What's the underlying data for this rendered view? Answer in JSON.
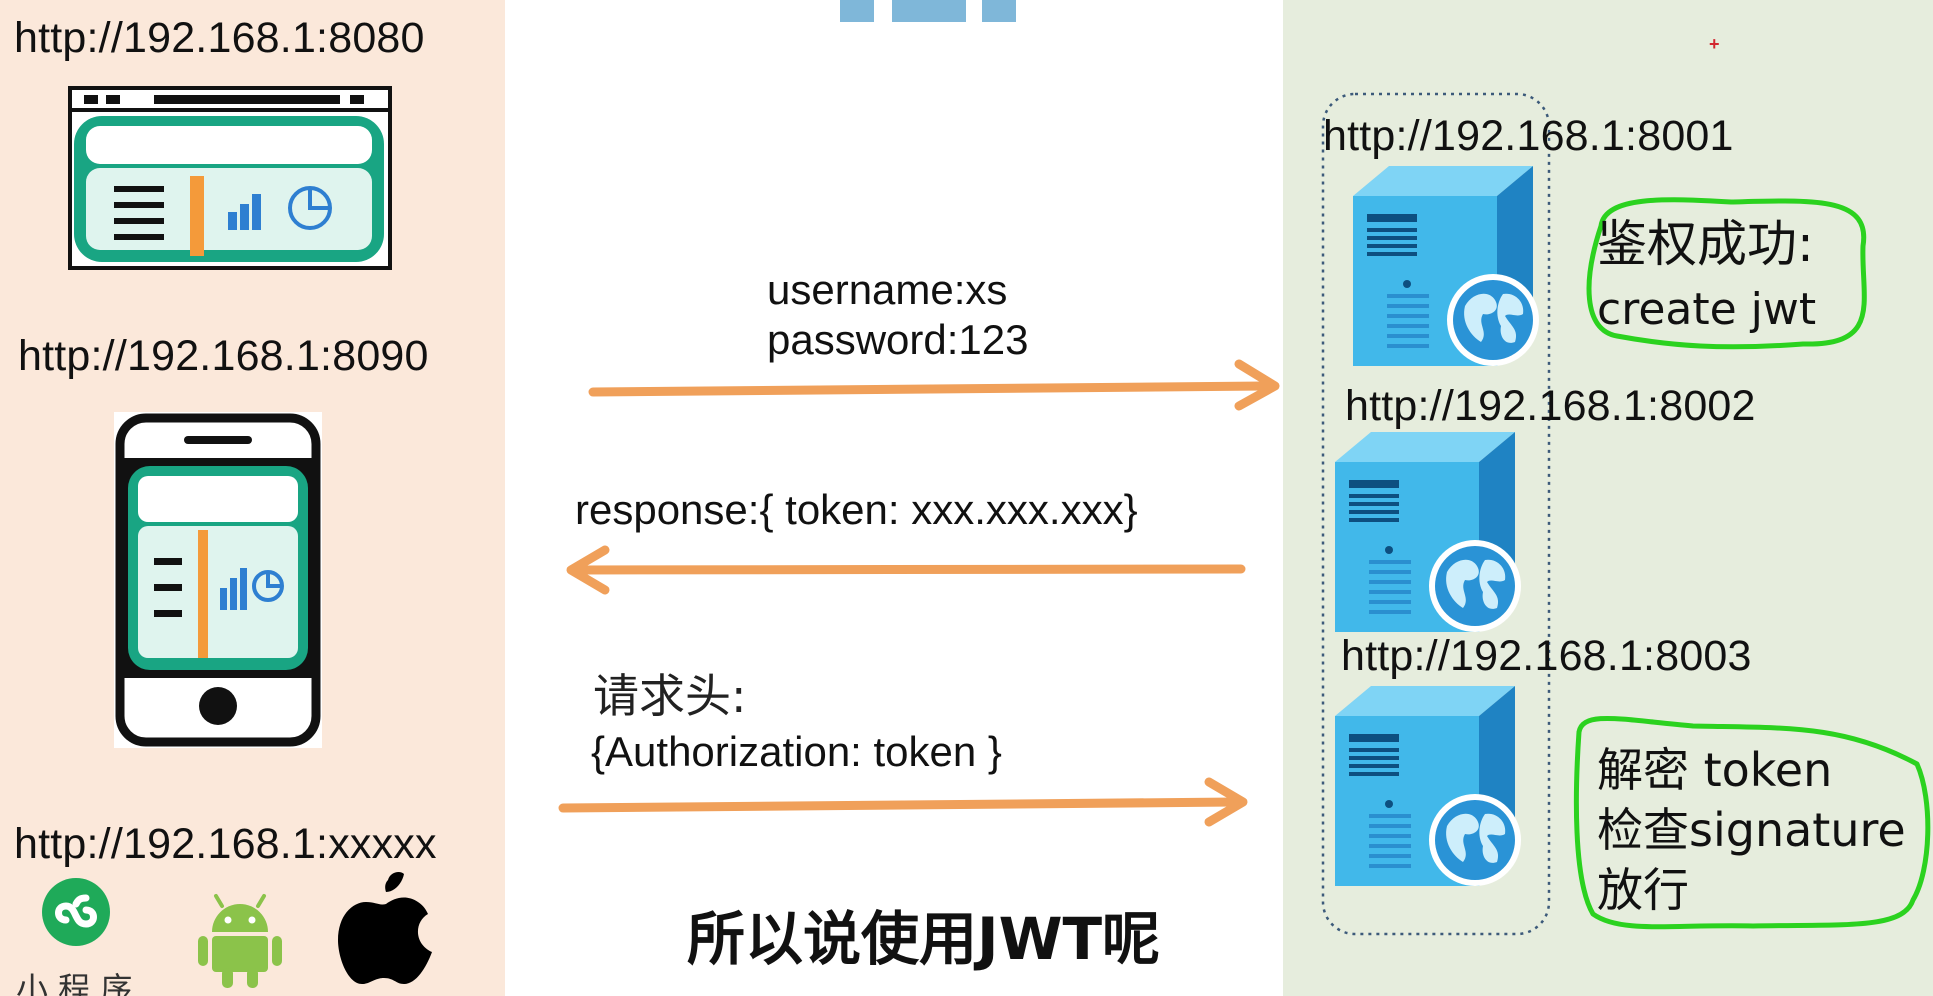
{
  "left": {
    "urls": {
      "web": "http://192.168.1:8080",
      "mobile": "http://192.168.1:8090",
      "other": "http://192.168.1:xxxxx"
    },
    "mini_program_label": "小 程 序"
  },
  "middle": {
    "login_request": [
      "username:xs",
      "password:123"
    ],
    "login_response": "response:{ token: xxx.xxx.xxx}",
    "auth_header": [
      "请求头:",
      "{Authorization: token }"
    ],
    "caption": "所以说使用JWT呢"
  },
  "right": {
    "servers": [
      {
        "url": "http://192.168.1:8001"
      },
      {
        "url": "http://192.168.1:8002"
      },
      {
        "url": "http://192.168.1:8003"
      }
    ],
    "note_auth": [
      "鉴权成功:",
      "create jwt"
    ],
    "note_verify": [
      "解密 token",
      "检查signature",
      "放行"
    ]
  },
  "colors": {
    "left_bg": "#fbe8da",
    "right_bg": "#e6eddd",
    "arrow": "#f0a05a",
    "highlight": "#2bd21f",
    "server_light": "#41b8ea",
    "server_dark": "#1f83c3",
    "app_teal": "#19a583"
  },
  "icons": [
    "browser-window-icon",
    "phone-icon",
    "wechat-mini-program-icon",
    "android-icon",
    "apple-icon",
    "server-icon",
    "globe-icon"
  ]
}
